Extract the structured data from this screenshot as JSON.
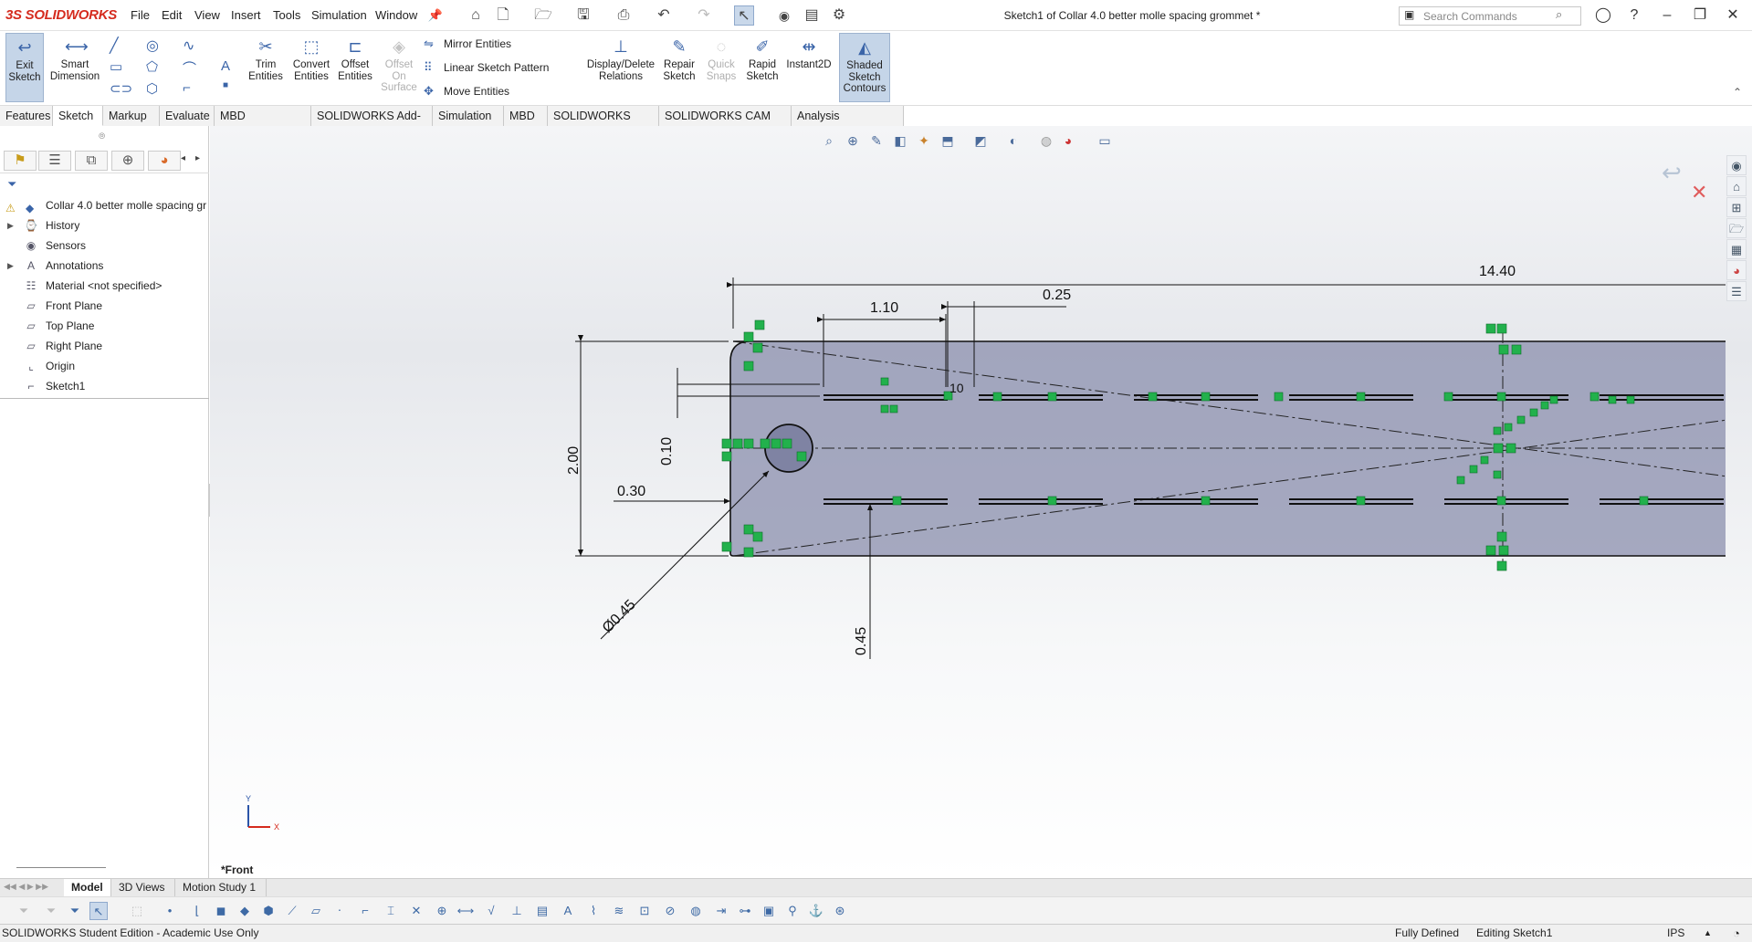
{
  "app": {
    "logo": "3S SOLIDWORKS",
    "title": "Sketch1 of Collar 4.0 better molle spacing grommet *"
  },
  "menu": [
    "File",
    "Edit",
    "View",
    "Insert",
    "Tools",
    "Simulation",
    "Window"
  ],
  "search": {
    "placeholder": "Search Commands"
  },
  "ribbon": {
    "exit_sketch": "Exit Sketch",
    "smart_dimension": "Smart Dimension",
    "trim_entities": "Trim Entities",
    "convert_entities": "Convert Entities",
    "offset_entities": "Offset Entities",
    "offset_on_surface": "Offset On Surface",
    "mirror_entities": "Mirror Entities",
    "linear_sketch_pattern": "Linear Sketch Pattern",
    "move_entities": "Move Entities",
    "display_delete_relations": "Display/Delete Relations",
    "repair_sketch": "Repair Sketch",
    "quick_snaps": "Quick Snaps",
    "rapid_sketch": "Rapid Sketch",
    "instant2d": "Instant2D",
    "shaded_sketch_contours": "Shaded Sketch Contours"
  },
  "tabs": [
    "Features",
    "Sketch",
    "Markup",
    "Evaluate",
    "MBD Dimensions",
    "SOLIDWORKS Add-Ins",
    "Simulation",
    "MBD",
    "SOLIDWORKS CAM",
    "SOLIDWORKS CAM TBM",
    "Analysis Preparation"
  ],
  "tree": {
    "root": "Collar 4.0 better molle spacing gr",
    "items": [
      "History",
      "Sensors",
      "Annotations",
      "Material <not specified>",
      "Front Plane",
      "Top Plane",
      "Right Plane",
      "Origin",
      "Sketch1"
    ]
  },
  "dimensions": {
    "d1": "14.40",
    "d2": "1.10",
    "d3": "0.25",
    "d4": "2.00",
    "d5": "0.10",
    "d6": "0.30",
    "d7": "Ø0.45",
    "d8": "0.45",
    "d9": "10"
  },
  "viewport": {
    "view_label": "*Front",
    "axis_y": "Y",
    "axis_x": "X"
  },
  "bottom_tabs": [
    "Model",
    "3D Views",
    "Motion Study 1"
  ],
  "status": {
    "left": "SOLIDWORKS Student Edition - Academic Use Only",
    "defined": "Fully Defined",
    "editing": "Editing Sketch1",
    "units": "IPS"
  },
  "colors": {
    "part_fill": "#8b8fad",
    "relation_green": "#22b14c",
    "accent": "#3a64a8",
    "logo_red": "#d52b1e"
  }
}
